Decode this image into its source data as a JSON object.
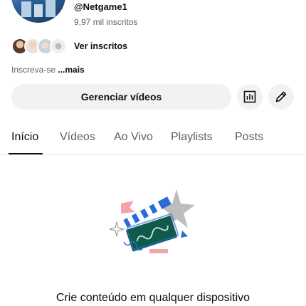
{
  "channel": {
    "handle": "@Netgame1",
    "subscribers": "9,97 mil inscritos",
    "view_subscribers_label": "Ver inscritos",
    "about_text": "Inscreva-se ",
    "about_more": "...mais"
  },
  "actions": {
    "manage_videos_label": "Gerenciar vídeos",
    "analytics_icon": "analytics-icon",
    "edit_icon": "pencil-icon"
  },
  "tabs": [
    {
      "label": "Início",
      "active": true
    },
    {
      "label": "Vídeos",
      "active": false
    },
    {
      "label": "Ao Vivo",
      "active": false
    },
    {
      "label": "Playlists",
      "active": false
    },
    {
      "label": "Posts",
      "active": false
    }
  ],
  "empty_state": {
    "title": "Crie conteúdo em qualquer dispositivo"
  },
  "colors": {
    "text_primary": "#0f0f0f",
    "text_secondary": "#606060",
    "button_bg": "#f2f2f2",
    "illustration_green": "#0f5a4a",
    "illustration_blue": "#2a6bd6",
    "illustration_pink": "#f3a3ad"
  }
}
